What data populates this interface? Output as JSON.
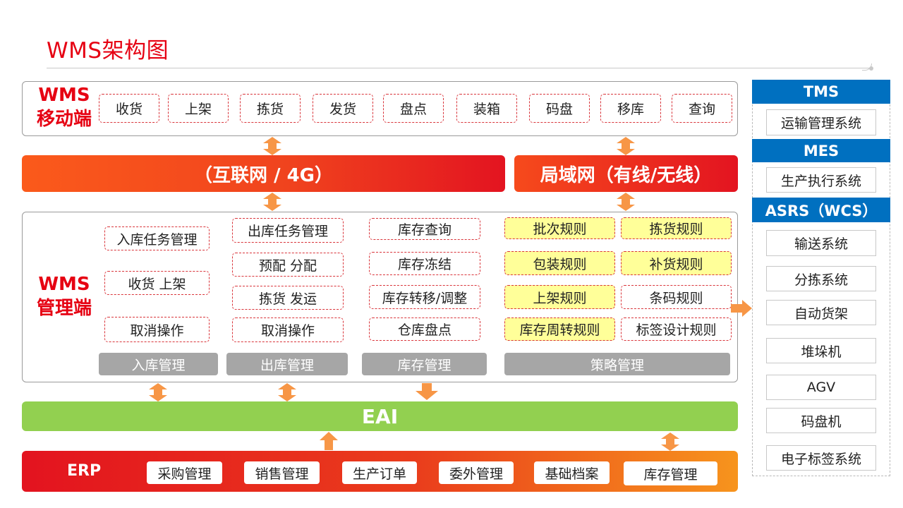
{
  "title": "WMS架构图",
  "mobile": {
    "label_line1": "WMS",
    "label_line2": "移动端",
    "items": [
      "收货",
      "上架",
      "拣货",
      "发货",
      "盘点",
      "装箱",
      "码盘",
      "移库",
      "查询"
    ]
  },
  "network": {
    "internet": "（互联网 / 4G）",
    "lan": "局域网（有线/无线）"
  },
  "management": {
    "label_line1": "WMS",
    "label_line2": "管理端",
    "inbound": {
      "category": "入库管理",
      "items": [
        "入库任务管理",
        "收货 上架",
        "取消操作"
      ]
    },
    "outbound": {
      "category": "出库管理",
      "items": [
        "出库任务管理",
        "预配 分配",
        "拣货 发运",
        "取消操作"
      ]
    },
    "inventory": {
      "category": "库存管理",
      "items": [
        "库存查询",
        "库存冻结",
        "库存转移/调整",
        "仓库盘点"
      ]
    },
    "strategy": {
      "category": "策略管理",
      "items": [
        "批次规则",
        "拣货规则",
        "包装规则",
        "补货规则",
        "上架规则",
        "条码规则",
        "库存周转规则",
        "标签设计规则"
      ]
    }
  },
  "eai": "EAI",
  "erp": {
    "label": "ERP",
    "items": [
      "采购管理",
      "销售管理",
      "生产订单",
      "委外管理",
      "基础档案",
      "库存管理"
    ]
  },
  "side": {
    "tms": {
      "head": "TMS",
      "item": "运输管理系统"
    },
    "mes": {
      "head": "MES",
      "item": "生产执行系统"
    },
    "asrs": {
      "head": "ASRS（WCS）",
      "items": [
        "输送系统",
        "分拣系统",
        "自动货架",
        "堆垛机",
        "AGV",
        "码盘机",
        "电子标签系统"
      ]
    }
  },
  "colors": {
    "title_red": "#e60012",
    "arrow_orange": "#f79646",
    "eai_green": "#92d050",
    "side_blue": "#0070c0",
    "highlight_yellow": "#ffff99",
    "category_gray": "#a6a6a6"
  }
}
